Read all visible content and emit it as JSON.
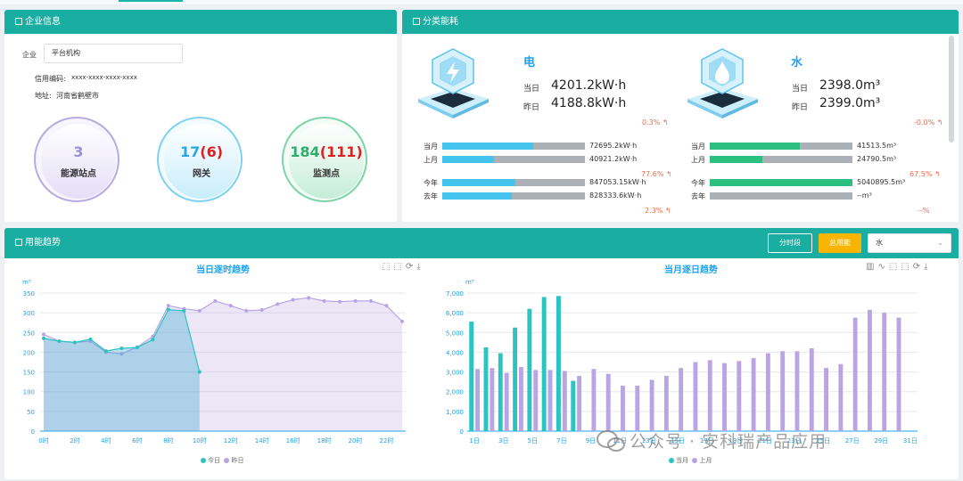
{
  "company_panel": {
    "title": "企业信息",
    "company_label": "企业",
    "company_value": "平台机构",
    "credit_label": "信用编码:",
    "credit_value": "xxxx-xxxx-xxxx-xxxx",
    "address_label": "地址:",
    "address_value": "河南省鹤壁市",
    "stats": [
      {
        "value": "3",
        "value_extra": "",
        "label": "能源站点",
        "color": "#9b8fd6"
      },
      {
        "value": "17",
        "value_extra": "(6)",
        "label": "网关",
        "color": "#2aa8e0"
      },
      {
        "value": "184",
        "value_extra": "(111)",
        "label": "监测点",
        "color": "#2fae6e"
      }
    ]
  },
  "energy_panel": {
    "title": "分类能耗",
    "electric": {
      "name": "电",
      "today_label": "当日",
      "today_value": "4201.2kW·h",
      "yesterday_label": "昨日",
      "yesterday_value": "4188.8kW·h",
      "day_change": "0.3%",
      "month_label": "当月",
      "month_value": "72695.2kW·h",
      "month_ratio": 0.64,
      "lastmonth_label": "上月",
      "lastmonth_value": "40921.2kW·h",
      "lastmonth_ratio": 0.36,
      "month_change": "77.6%",
      "year_label": "今年",
      "year_value": "847053.15kW·h",
      "year_ratio": 0.51,
      "lastyear_label": "去年",
      "lastyear_value": "828333.6kW·h",
      "lastyear_ratio": 0.49,
      "year_change": "2.3%",
      "color": "#45c3ef"
    },
    "water": {
      "name": "水",
      "today_label": "当日",
      "today_value": "2398.0m³",
      "yesterday_label": "昨日",
      "yesterday_value": "2399.0m³",
      "day_change": "-0.0%",
      "month_label": "当月",
      "month_value": "41513.5m³",
      "month_ratio": 0.63,
      "lastmonth_label": "上月",
      "lastmonth_value": "24790.5m³",
      "lastmonth_ratio": 0.37,
      "month_change": "67.5%",
      "year_label": "今年",
      "year_value": "5040895.5m³",
      "year_ratio": 1.0,
      "lastyear_label": "去年",
      "lastyear_value": "--m³",
      "lastyear_ratio": 0.0,
      "year_change": "--%",
      "color": "#2dbf7f"
    }
  },
  "trend_panel": {
    "title": "用能趋势",
    "btn_period": "分时段",
    "btn_total": "总用能",
    "select_value": "水",
    "watermark": "公众号 · 安科瑞产品应用"
  },
  "chart_data": [
    {
      "type": "area",
      "title": "当日逐时趋势",
      "unit": "m³",
      "ylim": [
        0,
        350
      ],
      "yticks": [
        0,
        50,
        100,
        150,
        200,
        250,
        300,
        350
      ],
      "x_tick_labels": [
        "0时",
        "2时",
        "4时",
        "6时",
        "8时",
        "10时",
        "12时",
        "14时",
        "16时",
        "18时",
        "20时",
        "22时"
      ],
      "x": [
        0,
        1,
        2,
        3,
        4,
        5,
        6,
        7,
        8,
        9,
        10,
        11,
        12,
        13,
        14,
        15,
        16,
        17,
        18,
        19,
        20,
        21,
        22,
        23
      ],
      "series": [
        {
          "name": "今日",
          "color": "#2bc4c2",
          "values": [
            235,
            228,
            225,
            233,
            203,
            210,
            212,
            232,
            308,
            305,
            150
          ]
        },
        {
          "name": "昨日",
          "color": "#b9a5e3",
          "values": [
            245,
            228,
            225,
            228,
            200,
            196,
            213,
            240,
            318,
            310,
            305,
            330,
            318,
            305,
            307,
            322,
            333,
            338,
            330,
            328,
            330,
            330,
            318,
            278
          ]
        }
      ],
      "legend": "bottom"
    },
    {
      "type": "bar",
      "title": "当月逐日趋势",
      "unit": "m³",
      "ylim": [
        0,
        7000
      ],
      "yticks": [
        0,
        1000,
        2000,
        3000,
        4000,
        5000,
        6000,
        7000
      ],
      "categories": [
        "1日",
        "2日",
        "3日",
        "4日",
        "5日",
        "6日",
        "7日",
        "8日",
        "9日",
        "10日",
        "11日",
        "12日",
        "13日",
        "14日",
        "15日",
        "16日",
        "17日",
        "18日",
        "19日",
        "20日",
        "21日",
        "22日",
        "23日",
        "24日",
        "25日",
        "26日",
        "27日",
        "28日",
        "29日",
        "30日",
        "31日"
      ],
      "x_tick_labels": [
        "1日",
        "3日",
        "5日",
        "7日",
        "9日",
        "11日",
        "13日",
        "15日",
        "17日",
        "19日",
        "21日",
        "23日",
        "25日",
        "27日",
        "29日",
        "31日"
      ],
      "series": [
        {
          "name": "当月",
          "color": "#2bc4c2",
          "values": [
            5550,
            4250,
            3950,
            5250,
            6200,
            6800,
            6850,
            2550
          ]
        },
        {
          "name": "上月",
          "color": "#b9a5e3",
          "values": [
            3150,
            3200,
            2950,
            3250,
            3100,
            3100,
            3050,
            2800,
            3150,
            2900,
            2300,
            2300,
            2600,
            2800,
            3200,
            3500,
            3600,
            3450,
            3550,
            3700,
            3950,
            4050,
            4050,
            4200,
            3200,
            3400,
            5750,
            6150,
            6000,
            5750,
            0
          ]
        }
      ],
      "legend": "bottom"
    }
  ]
}
